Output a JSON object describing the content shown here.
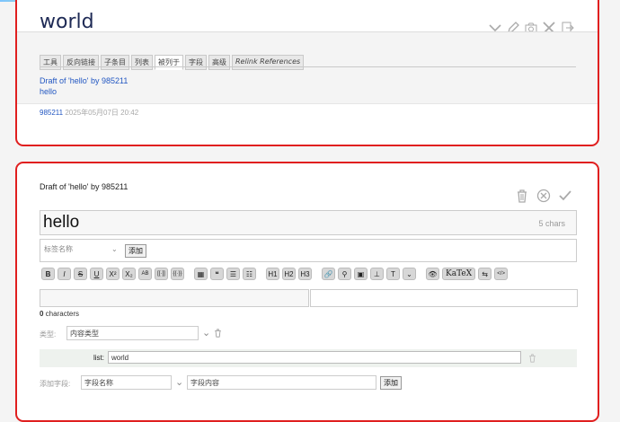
{
  "tiddler": {
    "title": "world",
    "tabs": [
      "工具",
      "反向链接",
      "子条目",
      "列表",
      "被列于",
      "字段",
      "高级",
      "Relink References"
    ],
    "active_tab": "被列于",
    "links": [
      "Draft of 'hello' by 985211",
      "hello"
    ],
    "modifier": "985211",
    "modified": "2025年05月07日 20:42"
  },
  "draft": {
    "title_label": "Draft of 'hello' by 985211",
    "title_value": "hello",
    "char_count": "5 chars",
    "tag_placeholder": "标签名称",
    "add_tag_button": "添加",
    "toolbar": [
      "B",
      "I",
      "S",
      "U",
      "X²",
      "X₂",
      "AB",
      "[[·]]",
      "{{·}}",
      "▦",
      "❝",
      "☰",
      "☷",
      "H1",
      "H2",
      "H3",
      "🔗",
      "⚲",
      "▣",
      "⊥",
      "T",
      "⌄",
      "👁",
      "KaTeX",
      "⇆",
      "</>"
    ],
    "body_count": "0",
    "body_count_label": " characters",
    "type_label": "类型:",
    "type_placeholder": "内容类型",
    "list_field_label": "list:",
    "list_field_value": "world",
    "add_field_label": "添加字段:",
    "field_name_placeholder": "字段名称",
    "field_value_placeholder": "字段内容",
    "add_field_button": "添加"
  },
  "colors": {
    "accent": "#e01f1f",
    "link": "#2257c2",
    "title": "#1e2a55"
  }
}
